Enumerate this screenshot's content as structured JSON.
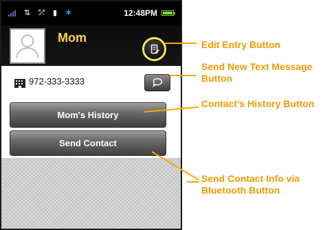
{
  "status_bar": {
    "time": "12:48PM",
    "icons": [
      "signal-bars-icon",
      "data-arrows-icon",
      "network-icon",
      "memory-card-icon",
      "bluetooth-icon",
      "battery-icon"
    ]
  },
  "contact": {
    "name": "Mom",
    "phone": "972-333-3333"
  },
  "buttons": {
    "history_label": "Mom's History",
    "send_contact_label": "Send Contact"
  },
  "callouts": {
    "edit_entry": "Edit Entry Button",
    "send_text": "Send New Text Message Button",
    "contact_history": "Contact’s History Button",
    "send_contact_info": "Send Contact Info via Bluetooth Button"
  },
  "colors": {
    "accent": "#f0ac00",
    "contact_name": "#ffd54a",
    "bluetooth": "#3fa2ff",
    "battery": "#7fdb3b"
  },
  "battery_level": 1.0
}
